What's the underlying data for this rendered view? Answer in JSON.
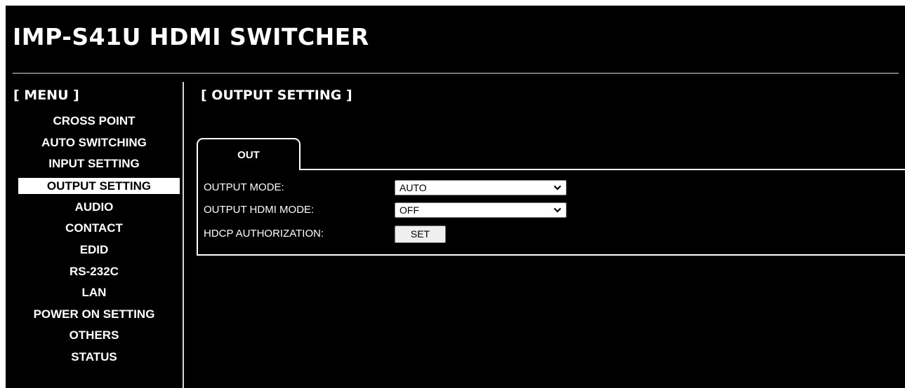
{
  "app": {
    "title": "IMP-S41U HDMI SWITCHER"
  },
  "sidebar": {
    "title": "[ MENU ]",
    "items": [
      {
        "label": "CROSS POINT"
      },
      {
        "label": "AUTO SWITCHING"
      },
      {
        "label": "INPUT SETTING"
      },
      {
        "label": "OUTPUT SETTING",
        "active": true
      },
      {
        "label": "AUDIO"
      },
      {
        "label": "CONTACT"
      },
      {
        "label": "EDID"
      },
      {
        "label": "RS-232C"
      },
      {
        "label": "LAN"
      },
      {
        "label": "POWER ON SETTING"
      },
      {
        "label": "OTHERS"
      },
      {
        "label": "STATUS"
      }
    ]
  },
  "main": {
    "title": "[ OUTPUT SETTING ]",
    "tabs": [
      {
        "label": "OUT",
        "active": true
      }
    ],
    "fields": {
      "output_mode": {
        "label": "OUTPUT MODE:",
        "value": "AUTO"
      },
      "output_hdmi_mode": {
        "label": "OUTPUT HDMI MODE:",
        "value": "OFF"
      },
      "hdcp_authorization": {
        "label": "HDCP AUTHORIZATION:",
        "button_label": "SET"
      }
    }
  },
  "colors": {
    "background": "#000000",
    "text": "#ffffff",
    "active_menu_background": "#ffffff",
    "active_menu_text": "#000000",
    "rule": "#d8d8d8"
  }
}
